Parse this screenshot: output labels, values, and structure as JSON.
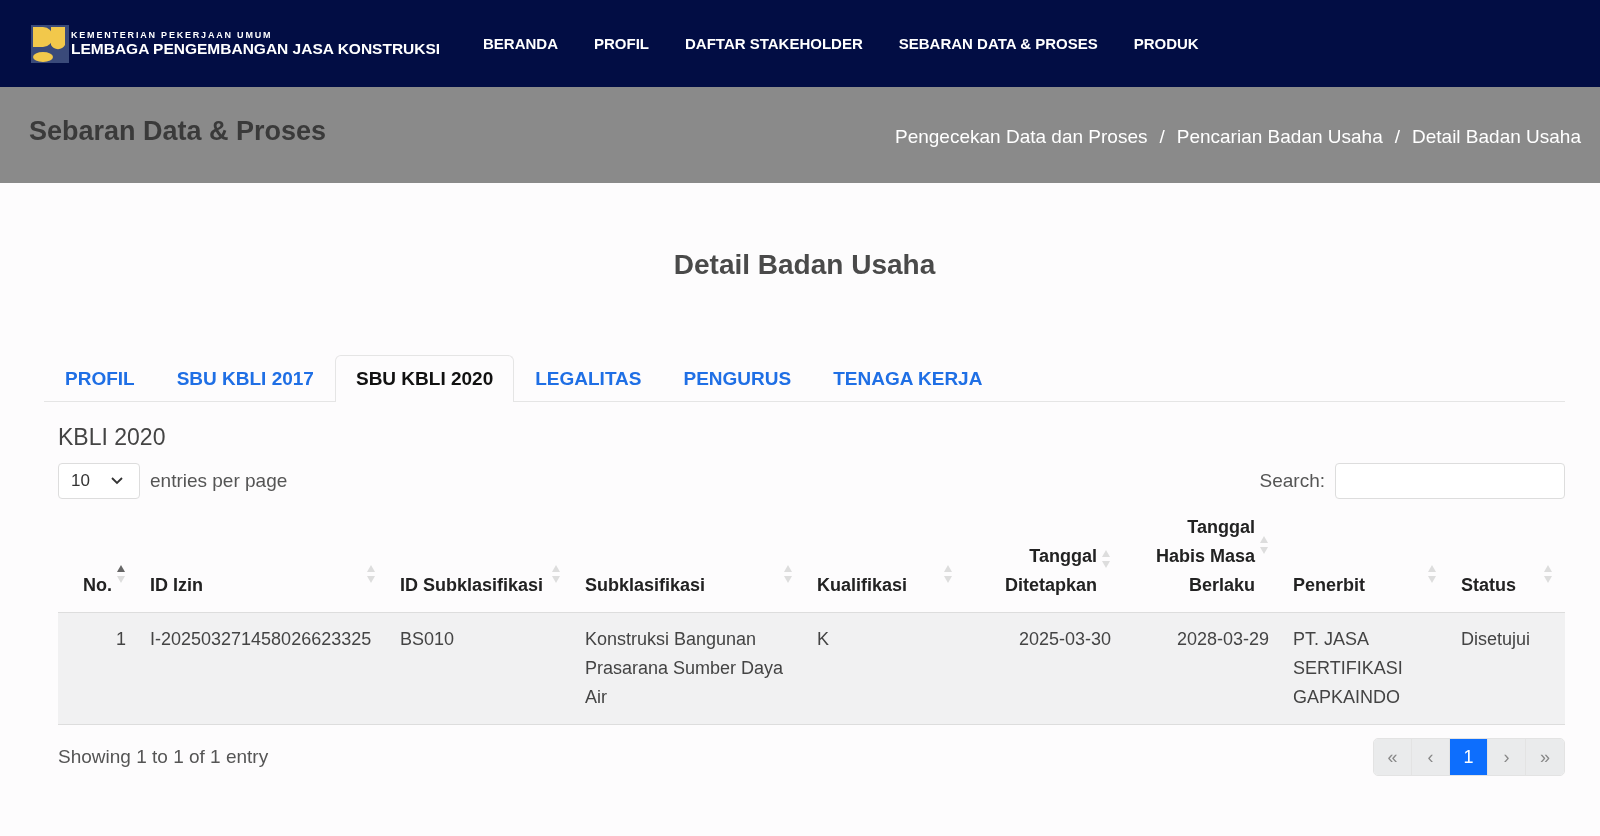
{
  "brand": {
    "subtitle": "KEMENTERIAN PEKERJAAN UMUM",
    "title": "LEMBAGA PENGEMBANGAN JASA KONSTRUKSI"
  },
  "nav": [
    "BERANDA",
    "PROFIL",
    "DAFTAR STAKEHOLDER",
    "SEBARAN DATA & PROSES",
    "PRODUK"
  ],
  "banner": {
    "title": "Sebaran Data & Proses",
    "breadcrumb": [
      {
        "kind": "link",
        "text": "Pengecekan Data dan Proses"
      },
      {
        "kind": "separator",
        "text": "/"
      },
      {
        "kind": "link",
        "text": "Pencarian Badan Usaha"
      },
      {
        "kind": "separator",
        "text": "/"
      },
      {
        "kind": "current",
        "text": "Detail Badan Usaha"
      }
    ]
  },
  "page_title": "Detail Badan Usaha",
  "tabs": [
    {
      "label": "PROFIL",
      "selected": false
    },
    {
      "label": "SBU KBLI 2017",
      "selected": false
    },
    {
      "label": "SBU KBLI 2020",
      "selected": true
    },
    {
      "label": "LEGALITAS",
      "selected": false
    },
    {
      "label": "PENGURUS",
      "selected": false
    },
    {
      "label": "TENAGA KERJA",
      "selected": false
    }
  ],
  "section_title": "KBLI 2020",
  "page_size": {
    "value": "10",
    "label": "entries per page"
  },
  "search": {
    "label": "Search:"
  },
  "table": {
    "columns": [
      {
        "label": "No.",
        "sorted": true
      },
      {
        "label": "ID Izin",
        "sorted": false
      },
      {
        "label": "ID Subklasifikasi",
        "sorted": false
      },
      {
        "label": "Subklasifikasi",
        "sorted": false
      },
      {
        "label": "Kualifikasi",
        "sorted": false
      },
      {
        "label": "Tanggal Ditetapkan",
        "sorted": false
      },
      {
        "label": "Tanggal Habis Masa Berlaku",
        "sorted": false
      },
      {
        "label": "Penerbit",
        "sorted": false
      },
      {
        "label": "Status",
        "sorted": false
      }
    ],
    "rows": [
      [
        "1",
        "I-202503271458026623325",
        "BS010",
        "Konstruksi Bangunan Prasarana Sumber Daya Air",
        "K",
        "2025-03-30",
        "2028-03-29",
        "PT. JASA SERTIFIKASI GAPKAINDO",
        "Disetujui"
      ]
    ]
  },
  "footer_info": "Showing 1 to 1 of 1 entry",
  "pagination": [
    {
      "label": "«",
      "selected": false,
      "disabled": true
    },
    {
      "label": "‹",
      "selected": false,
      "disabled": true
    },
    {
      "label": "1",
      "selected": true,
      "disabled": false
    },
    {
      "label": "›",
      "selected": false,
      "disabled": true
    },
    {
      "label": "»",
      "selected": false,
      "disabled": true
    }
  ]
}
